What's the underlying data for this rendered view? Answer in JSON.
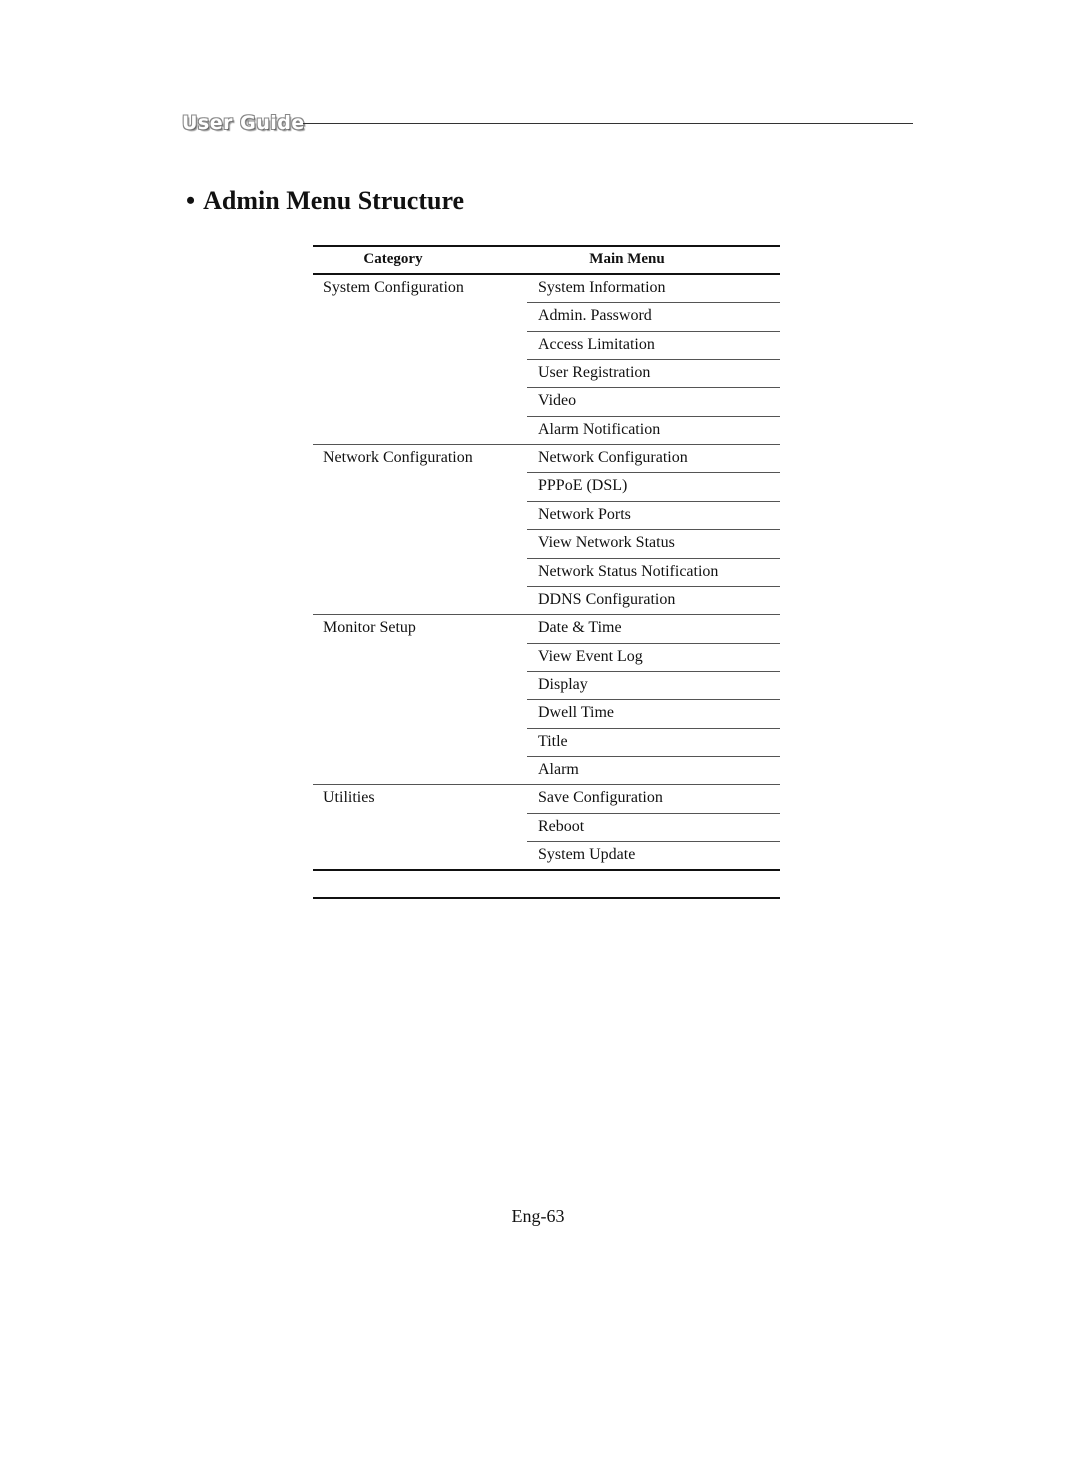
{
  "header": {
    "logo_text": "User Guide"
  },
  "title": {
    "bullet": "•",
    "text": "Admin Menu Structure"
  },
  "table": {
    "headers": {
      "category": "Category",
      "main_menu": "Main Menu"
    },
    "groups": [
      {
        "category": "System Configuration",
        "items": [
          "System Information",
          "Admin. Password",
          "Access Limitation",
          "User Registration",
          "Video",
          "Alarm Notification"
        ]
      },
      {
        "category": "Network Configuration",
        "items": [
          "Network Configuration",
          "PPPoE (DSL)",
          "Network Ports",
          "View Network Status",
          "Network Status Notification",
          "DDNS Configuration"
        ]
      },
      {
        "category": "Monitor Setup",
        "items": [
          "Date & Time",
          "View Event Log",
          "Display",
          "Dwell Time",
          "Title",
          "Alarm"
        ]
      },
      {
        "category": "Utilities",
        "items": [
          "Save Configuration",
          "Reboot",
          "System Update"
        ]
      }
    ]
  },
  "footer": {
    "page_number": "Eng-63"
  }
}
